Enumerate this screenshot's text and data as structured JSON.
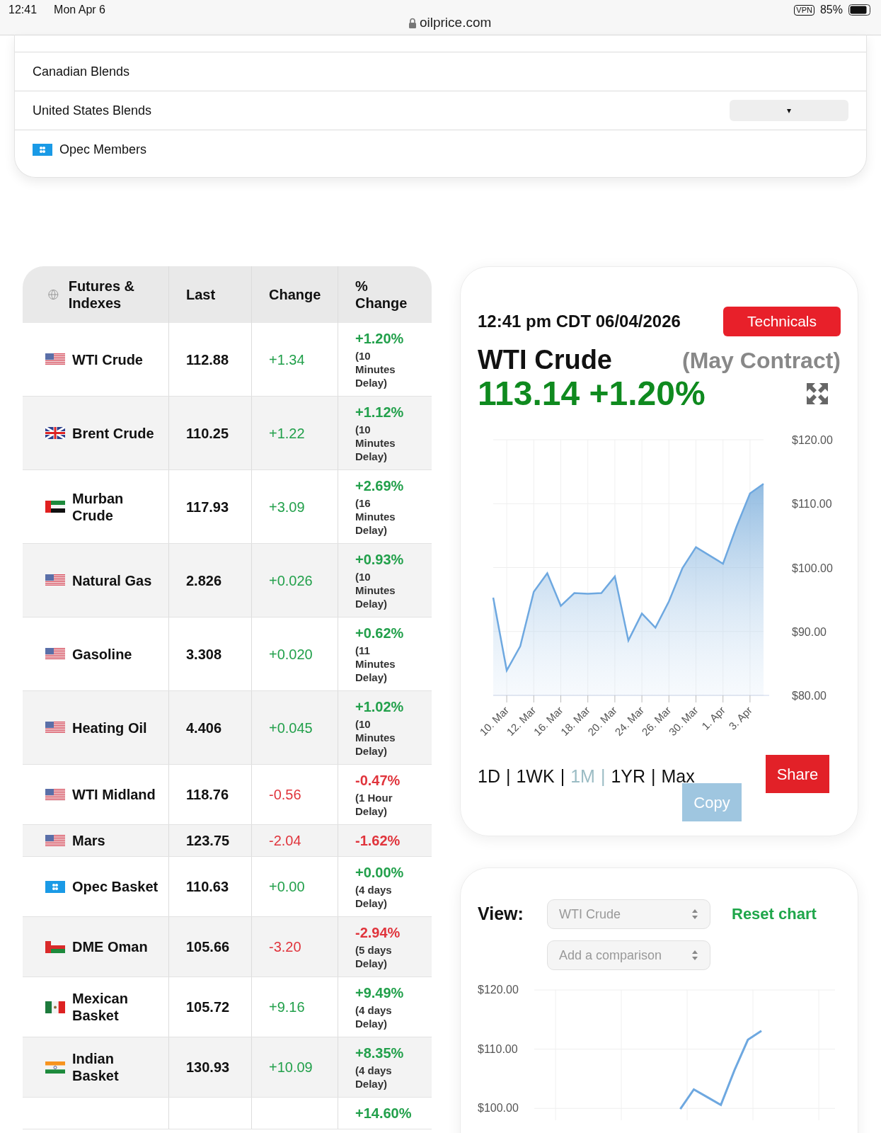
{
  "status_bar": {
    "time": "12:41",
    "date": "Mon Apr 6",
    "url": "oilprice.com",
    "vpn": "VPN",
    "battery": "85%"
  },
  "blends_menu": [
    {
      "label": "Canadian Blends",
      "dropdown": false
    },
    {
      "label": "United States Blends",
      "dropdown": true,
      "dropdown_glyph": "▾"
    },
    {
      "label": "Opec Members",
      "flag": {
        "kind": "opec"
      },
      "dropdown": false
    }
  ],
  "table": {
    "columns": [
      "Futures & Indexes",
      "Last",
      "Change",
      "% Change"
    ],
    "rows": [
      {
        "flag": {
          "kind": "us"
        },
        "name": "WTI Crude",
        "last": "112.88",
        "change": "+1.34",
        "pct": "+1.20%",
        "delay": "(10 Minutes Delay)",
        "color": "#22a04b"
      },
      {
        "flag": {
          "kind": "uk"
        },
        "name": "Brent Crude",
        "last": "110.25",
        "change": "+1.22",
        "pct": "+1.12%",
        "delay": "(10 Minutes Delay)",
        "color": "#22a04b"
      },
      {
        "flag": {
          "kind": "uae"
        },
        "name": "Murban Crude",
        "last": "117.93",
        "change": "+3.09",
        "pct": "+2.69%",
        "delay": "(16 Minutes Delay)",
        "color": "#22a04b"
      },
      {
        "flag": {
          "kind": "us"
        },
        "name": "Natural Gas",
        "last": "2.826",
        "change": "+0.026",
        "pct": "+0.93%",
        "delay": "(10 Minutes Delay)",
        "color": "#22a04b"
      },
      {
        "flag": {
          "kind": "us"
        },
        "name": "Gasoline",
        "last": "3.308",
        "change": "+0.020",
        "pct": "+0.62%",
        "delay": "(11 Minutes Delay)",
        "color": "#22a04b"
      },
      {
        "flag": {
          "kind": "us"
        },
        "name": "Heating Oil",
        "last": "4.406",
        "change": "+0.045",
        "pct": "+1.02%",
        "delay": "(10 Minutes Delay)",
        "color": "#22a04b"
      },
      {
        "flag": {
          "kind": "us"
        },
        "name": "WTI Midland",
        "last": "118.76",
        "change": "-0.56",
        "pct": "-0.47%",
        "delay": "(1 Hour Delay)",
        "color": "#e0343c"
      },
      {
        "flag": {
          "kind": "us"
        },
        "name": "Mars",
        "last": "123.75",
        "change": "-2.04",
        "pct": "-1.62%",
        "color": "#e0343c"
      },
      {
        "flag": {
          "kind": "opec"
        },
        "name": "Opec Basket",
        "last": "110.63",
        "change": "+0.00",
        "pct": "+0.00%",
        "delay": "(4 days Delay)",
        "color": "#22a04b"
      },
      {
        "flag": {
          "kind": "oman"
        },
        "name": "DME Oman",
        "last": "105.66",
        "change": "-3.20",
        "pct": "-2.94%",
        "delay": "(5 days Delay)",
        "color": "#e0343c"
      },
      {
        "flag": {
          "kind": "mexico"
        },
        "name": "Mexican Basket",
        "last": "105.72",
        "change": "+9.16",
        "pct": "+9.49%",
        "delay": "(4 days Delay)",
        "color": "#22a04b"
      },
      {
        "flag": {
          "kind": "india"
        },
        "name": "Indian Basket",
        "last": "130.93",
        "change": "+10.09",
        "pct": "+8.35%",
        "delay": "(4 days Delay)",
        "color": "#22a04b"
      },
      {
        "pct": "+14.60%",
        "color": "#22a04b"
      }
    ]
  },
  "quote_card": {
    "timestamp": "12:41 pm CDT 06/04/2026",
    "technicals_button": "Technicals",
    "name": "WTI Crude",
    "contract": "(May Contract)",
    "price": "113.14 +1.20%",
    "chart_data": {
      "type": "area",
      "grid": true,
      "categories": [
        null,
        "10. Mar",
        null,
        "12. Mar",
        null,
        "16. Mar",
        null,
        "18. Mar",
        null,
        "20. Mar",
        null,
        "24. Mar",
        null,
        "26. Mar",
        null,
        "30. Mar",
        null,
        "1. Apr",
        null,
        "3. Apr",
        null
      ],
      "series": [
        {
          "color": "#6ea8e0",
          "values": [
            95.3,
            83.9,
            87.7,
            96.2,
            99.1,
            94.0,
            96.0,
            95.9,
            96.0,
            98.6,
            88.6,
            92.8,
            90.6,
            94.7,
            99.9,
            103.2,
            101.9,
            100.6,
            106.4,
            111.6,
            113.1
          ]
        }
      ],
      "ylim": [
        80,
        120
      ],
      "yticks": [
        {
          "value": 80,
          "label": "$80.00"
        },
        {
          "value": 90,
          "label": "$90.00"
        },
        {
          "value": 100,
          "label": "$100.00"
        },
        {
          "value": 110,
          "label": "$110.00"
        },
        {
          "value": 120,
          "label": "$120.00"
        }
      ]
    },
    "periods": [
      {
        "label": "1D",
        "selected": false
      },
      {
        "label": "1WK",
        "selected": false
      },
      {
        "label": "1M",
        "selected": true
      },
      {
        "label": "1YR",
        "selected": false
      },
      {
        "label": "Max",
        "selected": false
      }
    ],
    "separator": "|",
    "share_button": "Share",
    "copy_button": "Copy"
  },
  "compare_card": {
    "view_label": "View:",
    "view_select": "WTI Crude",
    "comparison_select": "Add a comparison",
    "reset_link": "Reset chart",
    "chart_data": {
      "type": "line",
      "grid": true,
      "series": [
        {
          "color": "#6ea8e0",
          "values": [
            null,
            null,
            null,
            null,
            null,
            null,
            null,
            null,
            null,
            null,
            null,
            null,
            null,
            null,
            99.9,
            103.2,
            101.9,
            100.6,
            106.4,
            111.6,
            113.1
          ]
        }
      ],
      "ylim": [
        98,
        120
      ],
      "yticks": [
        {
          "value": 100,
          "label": "$100.00"
        },
        {
          "value": 110,
          "label": "$110.00"
        },
        {
          "value": 120,
          "label": "$120.00"
        }
      ]
    }
  }
}
